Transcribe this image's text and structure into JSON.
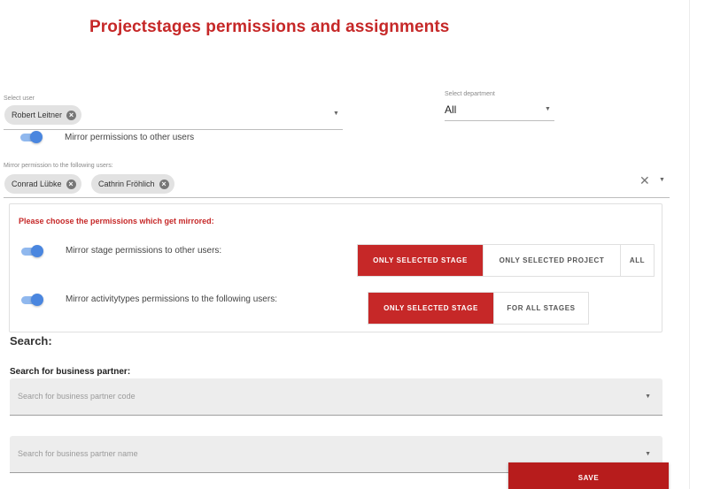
{
  "page": {
    "title": "Projectstages permissions and assignments"
  },
  "user_select": {
    "label": "Select user",
    "chips": [
      "Robert Leitner"
    ]
  },
  "department_select": {
    "label": "Select department",
    "value": "All"
  },
  "mirror_toggle": {
    "label": "Mirror permissions to other users",
    "checked": true
  },
  "mirror_users": {
    "label": "Mirror permission to the following users:",
    "chips": [
      "Conrad Lübke",
      "Cathrin Fröhlich"
    ]
  },
  "permissions_box": {
    "heading": "Please choose the permissions which get mirrored:",
    "stage_row": {
      "label": "Mirror stage permissions to other users:",
      "checked": true,
      "options": [
        "ONLY SELECTED STAGE",
        "ONLY SELECTED PROJECT",
        "ALL"
      ],
      "selected": "ONLY SELECTED STAGE"
    },
    "activity_row": {
      "label": "Mirror activitytypes permissions to the following users:",
      "checked": true,
      "options": [
        "ONLY SELECTED STAGE",
        "FOR ALL STAGES"
      ],
      "selected": "ONLY SELECTED STAGE"
    }
  },
  "search": {
    "heading": "Search:",
    "bp_heading": "Search for business partner:",
    "code_placeholder": "Search for business partner code",
    "name_placeholder": "Search for business partner name"
  },
  "save_label": "SAVE",
  "icons": {
    "chip_remove": "cancel-circle-icon",
    "clear": "close-icon",
    "dropdown": "caret-down-icon"
  },
  "colors": {
    "accent": "#c62828",
    "toggle": "#4a86df"
  }
}
